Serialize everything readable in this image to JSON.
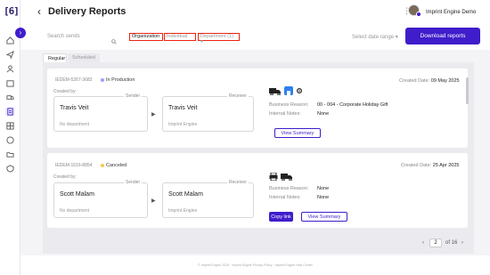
{
  "app": {
    "logo": "[6]",
    "title": "Delivery Reports",
    "user_name": "Imprint Engine Demo"
  },
  "filters": {
    "search_placeholder": "Search sends",
    "chips": [
      "Organization",
      "Individual",
      "Department (1)"
    ],
    "date_range": "Select date range",
    "download_label": "Download reports"
  },
  "tabs": [
    "Regular",
    "Scheduled"
  ],
  "labels": {
    "created_by": "Created by:",
    "sender": "Sender",
    "receiver": "Receiver",
    "created_date": "Created Date:",
    "business_reason": "Business Reason:",
    "internal_notes": "Internal Notes:",
    "view_summary": "View Summary",
    "copy_link": "Copy link"
  },
  "cards": [
    {
      "id": "IEDEM-5267-3683",
      "status": "In Production",
      "status_color": "#9aa0ff",
      "created_date": "09 May 2025",
      "sender_name": "Travis Veit",
      "sender_dept": "No department",
      "receiver_name": "Travis Veit",
      "receiver_org": "Imprint Engine",
      "business_reason": "00 - 004 - Corporate Holiday Gift",
      "internal_notes": "None",
      "icons": [
        "truck-icon",
        "building-icon",
        "gear-icon"
      ]
    },
    {
      "id": "IEDEM-1616-8854",
      "status": "Canceled",
      "status_color": "#f2c94c",
      "created_date": "25 Apr 2025",
      "sender_name": "Scott Malam",
      "sender_dept": "No department",
      "receiver_name": "Scott Malam",
      "receiver_org": "Imprint Engine",
      "business_reason": "None",
      "internal_notes": "None",
      "icons": [
        "printer-icon",
        "truck-icon"
      ]
    }
  ],
  "pagination": {
    "current": "2",
    "total": "of 16"
  },
  "footer": "© Imprint Engine 2025 · Imprint Engine Privacy Policy · Imprint Engine Help Center",
  "colors": {
    "accent": "#3f1dcb",
    "highlight": "#e21111"
  }
}
